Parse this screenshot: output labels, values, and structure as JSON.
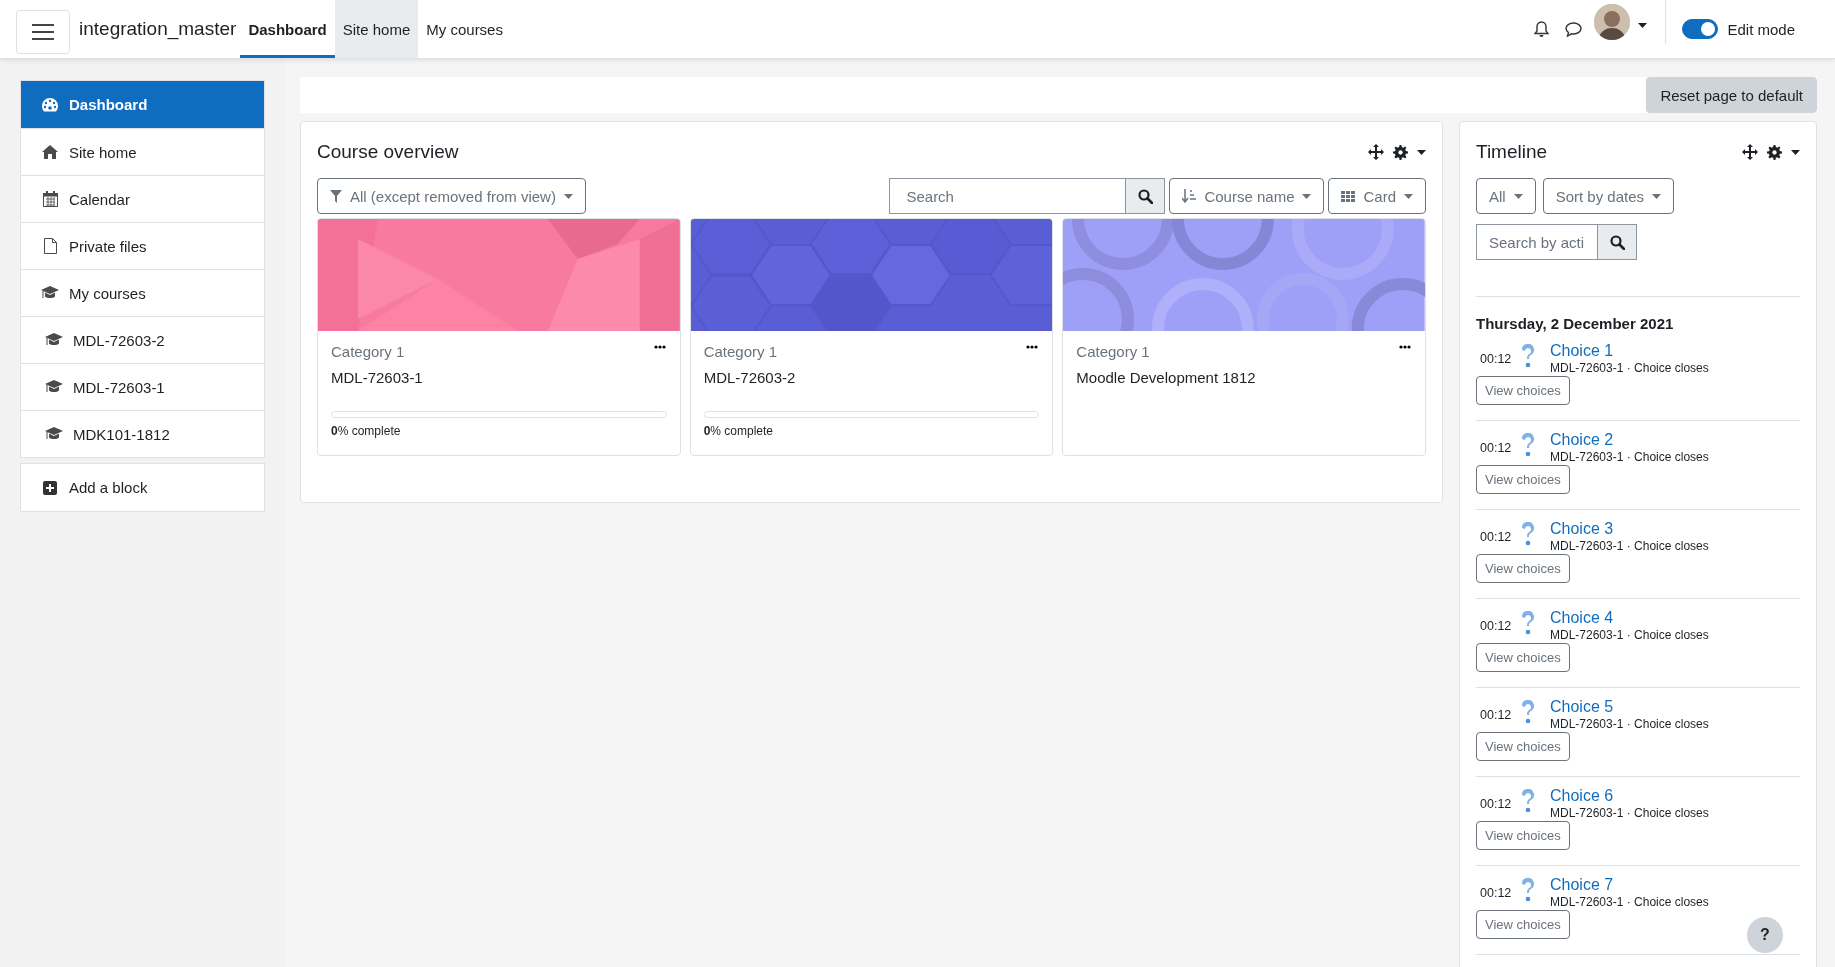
{
  "navbar": {
    "site_name": "integration_master",
    "tabs": [
      {
        "label": "Dashboard",
        "selected": true,
        "hovered": false
      },
      {
        "label": "Site home",
        "selected": false,
        "hovered": true
      },
      {
        "label": "My courses",
        "selected": false,
        "hovered": false
      }
    ],
    "edit_mode": {
      "label": "Edit mode",
      "on": true
    }
  },
  "sidebar": {
    "items": [
      {
        "label": "Dashboard",
        "kind": "link",
        "selected": true
      },
      {
        "label": "Site home",
        "kind": "link",
        "selected": false
      },
      {
        "label": "Calendar",
        "kind": "link",
        "selected": false
      },
      {
        "label": "Private files",
        "kind": "link",
        "selected": false
      },
      {
        "label": "My courses",
        "kind": "courses",
        "selected": false,
        "children": [
          {
            "label": "MDL-72603-2",
            "kind": "course",
            "selected": false
          },
          {
            "label": "MDL-72603-1",
            "kind": "course",
            "selected": false
          },
          {
            "label": "MDK101-1812",
            "kind": "course",
            "selected": false
          }
        ]
      }
    ],
    "add_block": "Add a block"
  },
  "reset_button": "Reset page to default",
  "course_overview": {
    "title": "Course overview",
    "filter": "All (except removed from view)",
    "search_placeholder": "Search",
    "sort": "Course name",
    "view": "Card",
    "courses": [
      {
        "category": "Category 1",
        "name": "MDL-72603-1",
        "progress": {
          "level": 0,
          "label": "**0**% complete"
        }
      },
      {
        "category": "Category 1",
        "name": "MDL-72603-2",
        "progress": {
          "level": 0,
          "label": "**0**% complete"
        }
      },
      {
        "category": "Category 1",
        "name": "Moodle Development 1812"
      }
    ]
  },
  "timeline": {
    "title": "Timeline",
    "filter": "All",
    "sort": "Sort by dates",
    "search_placeholder": "Search by acti",
    "date": "Thursday, 2 December 2021",
    "events": [
      {
        "time": "00:12",
        "title": "Choice 1",
        "subtitle": "MDL-72603-1 · Choice closes",
        "action": "View choices"
      },
      {
        "time": "00:12",
        "title": "Choice 2",
        "subtitle": "MDL-72603-1 · Choice closes",
        "action": "View choices"
      },
      {
        "time": "00:12",
        "title": "Choice 3",
        "subtitle": "MDL-72603-1 · Choice closes",
        "action": "View choices"
      },
      {
        "time": "00:12",
        "title": "Choice 4",
        "subtitle": "MDL-72603-1 · Choice closes",
        "action": "View choices"
      },
      {
        "time": "00:12",
        "title": "Choice 5",
        "subtitle": "MDL-72603-1 · Choice closes",
        "action": "View choices"
      },
      {
        "time": "00:12",
        "title": "Choice 6",
        "subtitle": "MDL-72603-1 · Choice closes",
        "action": "View choices"
      },
      {
        "time": "00:12",
        "title": "Choice 7",
        "subtitle": "MDL-72603-1 · Choice closes",
        "action": "View choices"
      }
    ]
  },
  "help_button": "?"
}
